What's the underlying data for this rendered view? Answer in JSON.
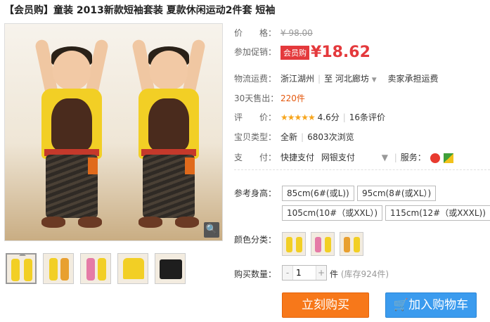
{
  "title": "【会员购】童装 2013新款短袖套装 夏款休闲运动2件套 短袖",
  "price": {
    "label": "价　　格：",
    "original": "¥ 98.00"
  },
  "promo": {
    "label": "参加促销：",
    "tag": "会员购",
    "currency": "¥",
    "value": "18.62"
  },
  "shipping": {
    "label": "物流运费：",
    "from": "浙江湖州",
    "sep": "至",
    "to": "河北廊坊",
    "note": "卖家承担运费"
  },
  "sales": {
    "label": "30天售出：",
    "count": "220",
    "unit": "件"
  },
  "rating": {
    "label": "评　　价：",
    "stars": "★★★★★",
    "score": "4.6分",
    "reviews": "16条评价"
  },
  "type": {
    "label": "宝贝类型：",
    "condition": "全新",
    "views": "6803次浏览"
  },
  "payment": {
    "label": "支　　付：",
    "method1": "快捷支付",
    "method2": "网银支付",
    "service_label": "服务："
  },
  "sizes": {
    "label": "参考身高：",
    "options": [
      "85cm(6#(或L))",
      "95cm(8#(或XL）)",
      "105cm(10#（或XXL）)",
      "115cm(12#（或XXXL))"
    ]
  },
  "colors": {
    "label": "颜色分类："
  },
  "quantity": {
    "label": "购买数量：",
    "value": "1",
    "minus": "-",
    "plus": "+",
    "unit": "件",
    "stock": "(库存924件)"
  },
  "actions": {
    "buy_now": "立刻购买",
    "add_cart": "加入购物车"
  },
  "icons": {
    "zoom": "magnifier-icon",
    "cart": "cart-icon",
    "dropdown": "chevron-down-icon"
  },
  "colors_theme": {
    "accent": "#e4393c",
    "buy": "#f7781a",
    "cart": "#3b9bee",
    "star": "#f7a51c"
  }
}
